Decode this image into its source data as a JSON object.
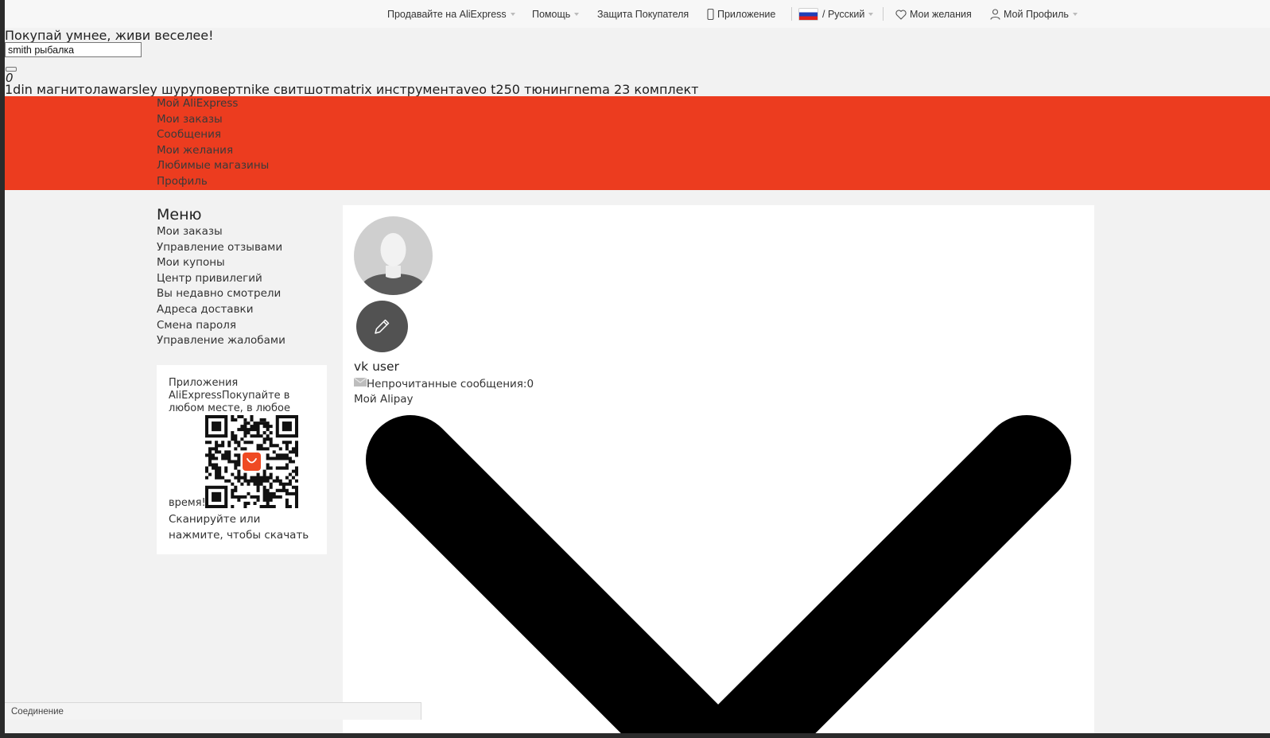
{
  "topbar": {
    "sell": "Продавайте на AliExpress",
    "help": "Помощь",
    "buyer_protection": "Защита Покупателя",
    "app": "Приложение",
    "language": "/ Русский",
    "wishlist": "Мои желания",
    "profile": "Мой Профиль"
  },
  "header": {
    "slogan": "Покупай умнее, живи веселее!",
    "search_value": "smith рыбалка",
    "cart_count": "0",
    "hot_words": "1din магнитолаwarsley шуруповертnike свитшотmatrix инструментaveo t250 тюнингnema 23 комплект"
  },
  "nav": {
    "items": [
      "Мой AliExpress",
      "Мои заказы",
      "Сообщения",
      "Мои желания",
      "Любимые магазины",
      "Профиль"
    ]
  },
  "menu": {
    "title": "Меню",
    "items": [
      "Мои заказы",
      "Управление отзывами",
      "Мои купоны",
      "Центр привилегий",
      "Вы недавно смотрели",
      "Адреса доставки",
      "Смена пароля",
      "Управление жалобами"
    ]
  },
  "app_box": {
    "title": "Приложения AliExpressПокупайте в любом месте, в любое",
    "time": "время!",
    "scan": "Сканируйте или нажмите, чтобы скачать",
    "qr_badge": "AliExpress"
  },
  "profile": {
    "username": "vk user",
    "unread_label": "Непрочитанные сообщения:",
    "unread_count": "0",
    "alipay": "Мой Alipay"
  },
  "statusbar": {
    "text": "Соединение"
  },
  "colors": {
    "brand_red": "#ec3c1f",
    "page_bg": "#f2f2f2",
    "topbar_bg": "#f7f7f7"
  }
}
